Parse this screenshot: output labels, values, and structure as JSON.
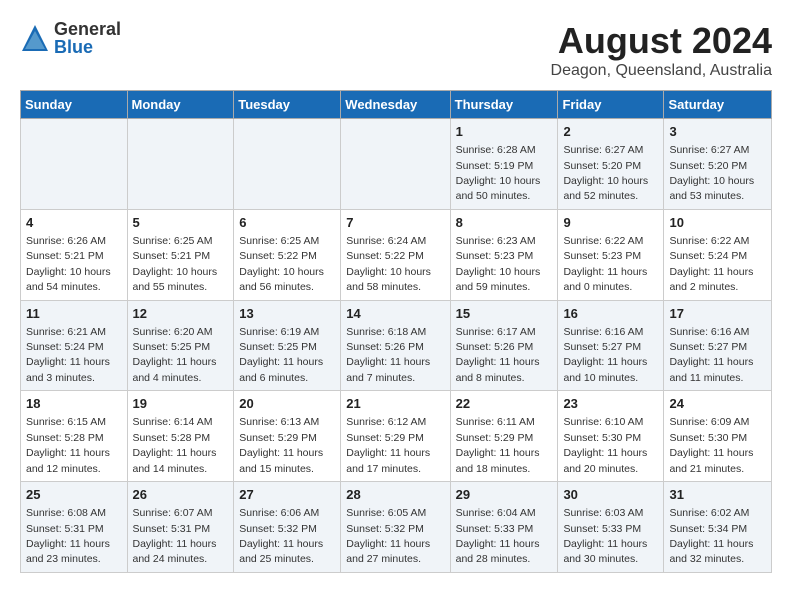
{
  "logo": {
    "general": "General",
    "blue": "Blue"
  },
  "title": "August 2024",
  "subtitle": "Deagon, Queensland, Australia",
  "headers": [
    "Sunday",
    "Monday",
    "Tuesday",
    "Wednesday",
    "Thursday",
    "Friday",
    "Saturday"
  ],
  "weeks": [
    [
      {
        "day": "",
        "info": ""
      },
      {
        "day": "",
        "info": ""
      },
      {
        "day": "",
        "info": ""
      },
      {
        "day": "",
        "info": ""
      },
      {
        "day": "1",
        "info": "Sunrise: 6:28 AM\nSunset: 5:19 PM\nDaylight: 10 hours\nand 50 minutes."
      },
      {
        "day": "2",
        "info": "Sunrise: 6:27 AM\nSunset: 5:20 PM\nDaylight: 10 hours\nand 52 minutes."
      },
      {
        "day": "3",
        "info": "Sunrise: 6:27 AM\nSunset: 5:20 PM\nDaylight: 10 hours\nand 53 minutes."
      }
    ],
    [
      {
        "day": "4",
        "info": "Sunrise: 6:26 AM\nSunset: 5:21 PM\nDaylight: 10 hours\nand 54 minutes."
      },
      {
        "day": "5",
        "info": "Sunrise: 6:25 AM\nSunset: 5:21 PM\nDaylight: 10 hours\nand 55 minutes."
      },
      {
        "day": "6",
        "info": "Sunrise: 6:25 AM\nSunset: 5:22 PM\nDaylight: 10 hours\nand 56 minutes."
      },
      {
        "day": "7",
        "info": "Sunrise: 6:24 AM\nSunset: 5:22 PM\nDaylight: 10 hours\nand 58 minutes."
      },
      {
        "day": "8",
        "info": "Sunrise: 6:23 AM\nSunset: 5:23 PM\nDaylight: 10 hours\nand 59 minutes."
      },
      {
        "day": "9",
        "info": "Sunrise: 6:22 AM\nSunset: 5:23 PM\nDaylight: 11 hours\nand 0 minutes."
      },
      {
        "day": "10",
        "info": "Sunrise: 6:22 AM\nSunset: 5:24 PM\nDaylight: 11 hours\nand 2 minutes."
      }
    ],
    [
      {
        "day": "11",
        "info": "Sunrise: 6:21 AM\nSunset: 5:24 PM\nDaylight: 11 hours\nand 3 minutes."
      },
      {
        "day": "12",
        "info": "Sunrise: 6:20 AM\nSunset: 5:25 PM\nDaylight: 11 hours\nand 4 minutes."
      },
      {
        "day": "13",
        "info": "Sunrise: 6:19 AM\nSunset: 5:25 PM\nDaylight: 11 hours\nand 6 minutes."
      },
      {
        "day": "14",
        "info": "Sunrise: 6:18 AM\nSunset: 5:26 PM\nDaylight: 11 hours\nand 7 minutes."
      },
      {
        "day": "15",
        "info": "Sunrise: 6:17 AM\nSunset: 5:26 PM\nDaylight: 11 hours\nand 8 minutes."
      },
      {
        "day": "16",
        "info": "Sunrise: 6:16 AM\nSunset: 5:27 PM\nDaylight: 11 hours\nand 10 minutes."
      },
      {
        "day": "17",
        "info": "Sunrise: 6:16 AM\nSunset: 5:27 PM\nDaylight: 11 hours\nand 11 minutes."
      }
    ],
    [
      {
        "day": "18",
        "info": "Sunrise: 6:15 AM\nSunset: 5:28 PM\nDaylight: 11 hours\nand 12 minutes."
      },
      {
        "day": "19",
        "info": "Sunrise: 6:14 AM\nSunset: 5:28 PM\nDaylight: 11 hours\nand 14 minutes."
      },
      {
        "day": "20",
        "info": "Sunrise: 6:13 AM\nSunset: 5:29 PM\nDaylight: 11 hours\nand 15 minutes."
      },
      {
        "day": "21",
        "info": "Sunrise: 6:12 AM\nSunset: 5:29 PM\nDaylight: 11 hours\nand 17 minutes."
      },
      {
        "day": "22",
        "info": "Sunrise: 6:11 AM\nSunset: 5:29 PM\nDaylight: 11 hours\nand 18 minutes."
      },
      {
        "day": "23",
        "info": "Sunrise: 6:10 AM\nSunset: 5:30 PM\nDaylight: 11 hours\nand 20 minutes."
      },
      {
        "day": "24",
        "info": "Sunrise: 6:09 AM\nSunset: 5:30 PM\nDaylight: 11 hours\nand 21 minutes."
      }
    ],
    [
      {
        "day": "25",
        "info": "Sunrise: 6:08 AM\nSunset: 5:31 PM\nDaylight: 11 hours\nand 23 minutes."
      },
      {
        "day": "26",
        "info": "Sunrise: 6:07 AM\nSunset: 5:31 PM\nDaylight: 11 hours\nand 24 minutes."
      },
      {
        "day": "27",
        "info": "Sunrise: 6:06 AM\nSunset: 5:32 PM\nDaylight: 11 hours\nand 25 minutes."
      },
      {
        "day": "28",
        "info": "Sunrise: 6:05 AM\nSunset: 5:32 PM\nDaylight: 11 hours\nand 27 minutes."
      },
      {
        "day": "29",
        "info": "Sunrise: 6:04 AM\nSunset: 5:33 PM\nDaylight: 11 hours\nand 28 minutes."
      },
      {
        "day": "30",
        "info": "Sunrise: 6:03 AM\nSunset: 5:33 PM\nDaylight: 11 hours\nand 30 minutes."
      },
      {
        "day": "31",
        "info": "Sunrise: 6:02 AM\nSunset: 5:34 PM\nDaylight: 11 hours\nand 32 minutes."
      }
    ]
  ]
}
